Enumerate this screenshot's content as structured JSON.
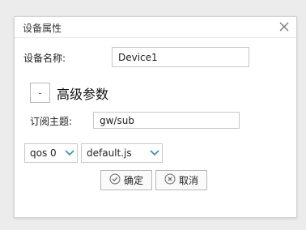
{
  "dialog": {
    "title": "设备属性",
    "close_icon": "close-icon"
  },
  "device_name": {
    "label": "设备名称:",
    "value": "Device1"
  },
  "advanced": {
    "toggle_symbol": "-",
    "title": "高级参数"
  },
  "topic": {
    "label": "订阅主题:",
    "value": "gw/sub"
  },
  "qos_select": {
    "value": "qos 0",
    "icon": "chevron-down-icon"
  },
  "script_select": {
    "value": "default.js",
    "icon": "chevron-down-icon"
  },
  "buttons": {
    "confirm": {
      "label": "确定",
      "icon": "check-circle-icon"
    },
    "cancel": {
      "label": "取消",
      "icon": "x-circle-icon"
    }
  },
  "colors": {
    "chevron": "#3a86d1",
    "border": "#c8c8c8"
  }
}
